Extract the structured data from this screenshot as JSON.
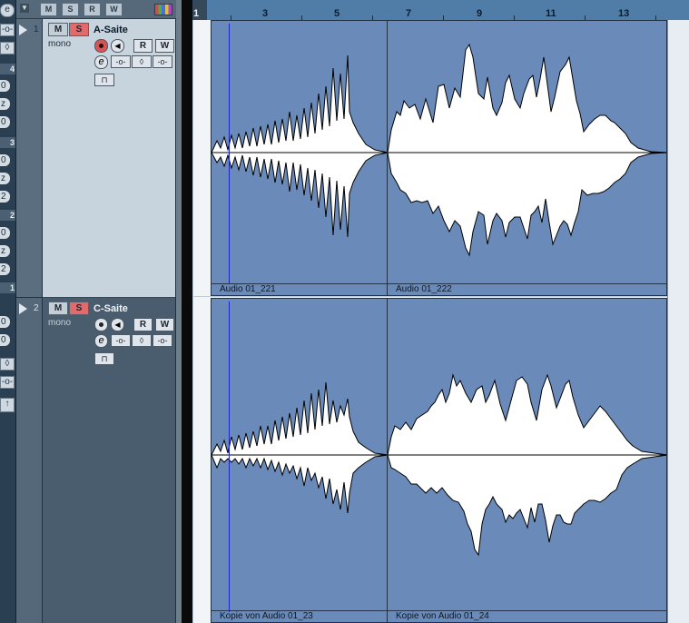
{
  "header": {
    "buttons": [
      "M",
      "S",
      "R",
      "W"
    ],
    "colors_icon": "color-palette-icon"
  },
  "inspector_strip": {
    "numbers": [
      "4",
      "3",
      "2",
      "1"
    ],
    "values": [
      "0",
      "z",
      "0",
      "z",
      "2",
      "0",
      "z",
      "2",
      "0",
      "0"
    ],
    "top_icon": "e"
  },
  "ruler": {
    "start": "1",
    "bars": [
      "3",
      "5",
      "7",
      "9",
      "11",
      "13"
    ]
  },
  "tracks": [
    {
      "number": "1",
      "name": "A-Saite",
      "mode": "mono",
      "mute": "M",
      "solo": "S",
      "read": "R",
      "write": "W",
      "edit": "e",
      "selected": true,
      "events": [
        "Audio 01_221",
        "Audio 01_222"
      ]
    },
    {
      "number": "2",
      "name": "C-Saite",
      "mode": "mono",
      "mute": "M",
      "solo": "S",
      "read": "R",
      "write": "W",
      "edit": "e",
      "selected": false,
      "events": [
        "Kopie von Audio 01_23",
        "Kopie von Audio 01_24"
      ]
    }
  ],
  "colors": {
    "event": "#6a8bb9",
    "solo": "#e26a6a",
    "playhead": "#1b25c8",
    "ruler": "#4f7da8"
  }
}
